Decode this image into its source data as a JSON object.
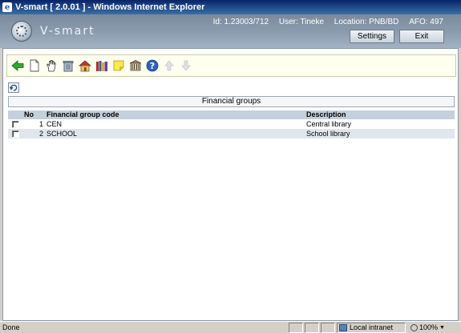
{
  "window": {
    "title": "V-smart [ 2.0.01 ] - Windows Internet Explorer"
  },
  "header": {
    "brand": "V-smart",
    "session": {
      "id": "Id: 1.23003/712",
      "user": "User: Tineke",
      "location": "Location: PNB/BD",
      "afo": "AFO: 497"
    },
    "settings_label": "Settings",
    "exit_label": "Exit"
  },
  "toolbar": {
    "icons": [
      "back-arrow-icon",
      "new-document-icon",
      "hand-icon",
      "trash-icon",
      "house-icon",
      "books-icon",
      "note-icon",
      "library-icon",
      "help-icon",
      "arrow-up-icon",
      "arrow-down-icon"
    ]
  },
  "panel": {
    "title": "Financial groups"
  },
  "table": {
    "columns": {
      "no": "No",
      "code": "Financial group code",
      "description": "Description"
    },
    "rows": [
      {
        "no": "1",
        "code": "CEN",
        "description": "Central library"
      },
      {
        "no": "2",
        "code": "SCHOOL",
        "description": "School library"
      }
    ]
  },
  "status": {
    "text": "Done",
    "zone": "Local intranet",
    "zoom": "100%"
  },
  "colors": {
    "title_bar": "#0a246a",
    "header": "#8d9db0",
    "table_header": "#c4d0dc",
    "alt_row": "#dfe6ee"
  }
}
